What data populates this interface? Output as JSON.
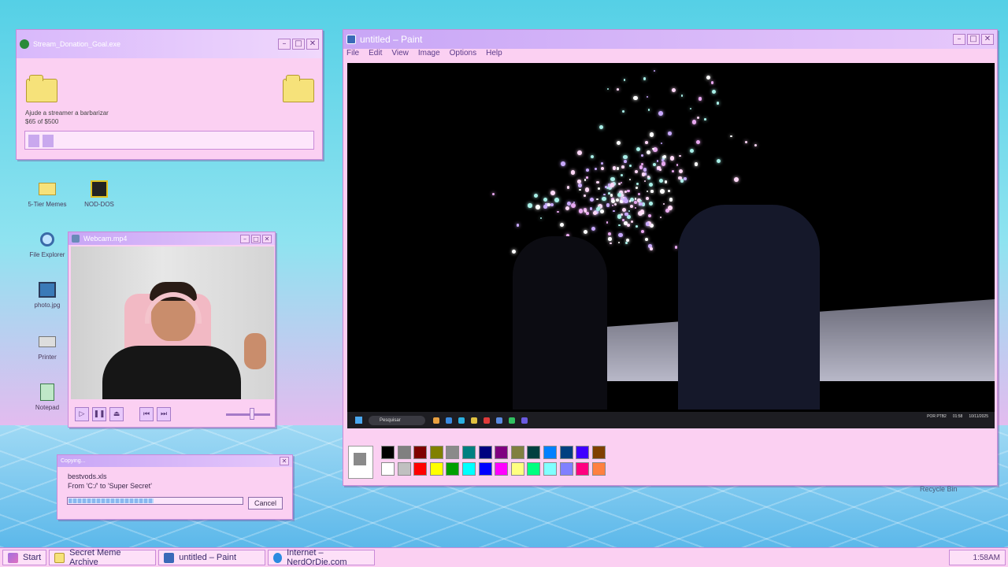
{
  "donation": {
    "title": "Stream_Donation_Goal.exe",
    "message": "Ajude a streamer a barbarizar",
    "progress_text": "$65 of $500",
    "progress_fraction": 0.13
  },
  "desktop_icons": [
    {
      "label": "5-Tier Memes",
      "icon": "folder-icon"
    },
    {
      "label": "NOD-DOS",
      "icon": "nod-dos-icon"
    },
    {
      "label": "File Explorer",
      "icon": "magnifier-icon"
    },
    {
      "label": "photo.jpg",
      "icon": "image-icon"
    },
    {
      "label": "Printer",
      "icon": "printer-icon"
    },
    {
      "label": "Notepad",
      "icon": "notepad-icon"
    }
  ],
  "webcam": {
    "title": "Webcam.mp4"
  },
  "copy_dialog": {
    "title": "Copying...",
    "filename": "bestvods.xls",
    "path": "From 'C:/' to 'Super Secret'",
    "cancel_label": "Cancel",
    "progress_fraction": 0.49
  },
  "paint": {
    "title": "untitled – Paint",
    "menu": [
      "File",
      "Edit",
      "View",
      "Image",
      "Options",
      "Help"
    ],
    "embedded_taskbar": {
      "search_placeholder": "Pesquisar",
      "tray_lang": "POR PTB2",
      "tray_time": "01:58",
      "tray_date": "10/11/2025"
    },
    "palette": {
      "top": [
        "#000000",
        "#808080",
        "#800000",
        "#808000",
        "#8a8a8a",
        "#008080",
        "#000080",
        "#800080",
        "#808040",
        "#004040",
        "#0080ff",
        "#004080",
        "#4000ff",
        "#804000"
      ],
      "bottom": [
        "#ffffff",
        "#c0c0c0",
        "#ff0000",
        "#ffff00",
        "#00a000",
        "#00ffff",
        "#0000ff",
        "#ff00ff",
        "#ffff80",
        "#00ff80",
        "#80ffff",
        "#8080ff",
        "#ff0080",
        "#ff8040"
      ]
    }
  },
  "taskbar": {
    "start_label": "Start",
    "items": [
      {
        "label": "Secret Meme Archive",
        "icon": "folder-icon"
      },
      {
        "label": "untitled – Paint",
        "icon": "paint-icon"
      },
      {
        "label": "Internet – NerdOrDie.com",
        "icon": "globe-icon"
      }
    ],
    "clock": "1:58AM"
  },
  "desktop": {
    "recycle_bin_label": "Recycle Bin"
  }
}
